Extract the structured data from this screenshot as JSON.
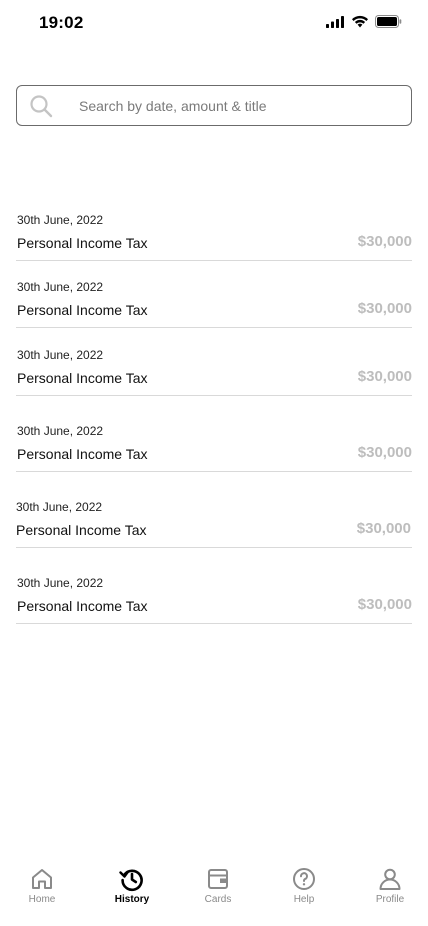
{
  "status_bar": {
    "time": "19:02"
  },
  "search": {
    "placeholder": "Search by date, amount & title",
    "value": ""
  },
  "transactions": [
    {
      "date": "30th June, 2022",
      "title": "Personal Income Tax",
      "amount": "$30,000"
    },
    {
      "date": "30th June, 2022",
      "title": "Personal Income Tax",
      "amount": "$30,000"
    },
    {
      "date": "30th June, 2022",
      "title": "Personal Income Tax",
      "amount": "$30,000"
    },
    {
      "date": "30th June, 2022",
      "title": "Personal Income Tax",
      "amount": "$30,000"
    },
    {
      "date": "30th June, 2022",
      "title": "Personal Income Tax",
      "amount": "$30,000"
    },
    {
      "date": "30th June, 2022",
      "title": "Personal Income Tax",
      "amount": "$30,000"
    }
  ],
  "bottom_nav": {
    "active": "history",
    "items": [
      {
        "id": "home",
        "label": "Home",
        "icon": "home-icon"
      },
      {
        "id": "history",
        "label": "History",
        "icon": "history-icon"
      },
      {
        "id": "cards",
        "label": "Cards",
        "icon": "wallet-icon"
      },
      {
        "id": "help",
        "label": "Help",
        "icon": "help-icon"
      },
      {
        "id": "profile",
        "label": "Profile",
        "icon": "profile-icon"
      }
    ]
  },
  "colors": {
    "amount": "#bdbdbd",
    "divider": "#d9d9d9",
    "nav_inactive": "#8a8a8a",
    "nav_active": "#000000"
  }
}
